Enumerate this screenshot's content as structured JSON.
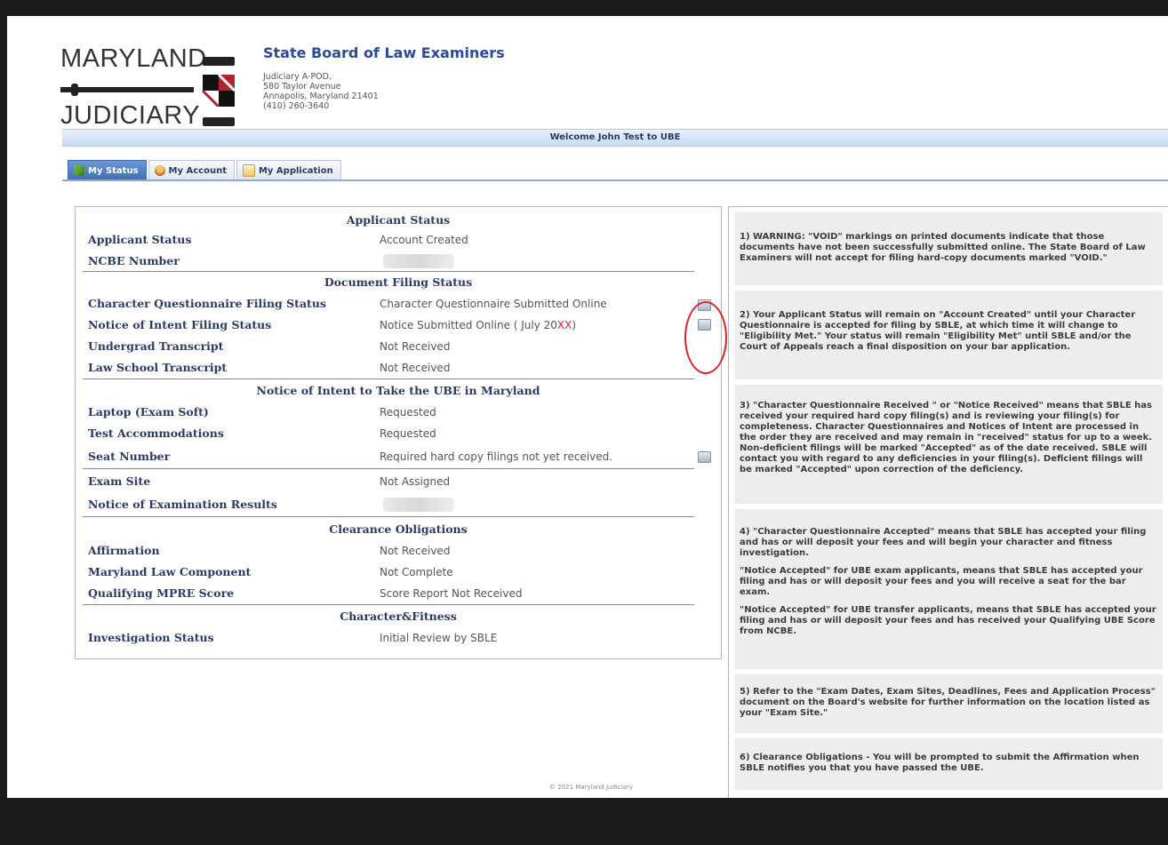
{
  "header": {
    "logo_top": "MARYLAND",
    "logo_bottom": "JUDICIARY",
    "org_title": "State Board of Law Examiners",
    "address": [
      "Judiciary A-POD,",
      "580 Taylor Avenue",
      "Annapolis, Maryland 21401",
      "(410) 260-3640"
    ]
  },
  "welcome": "Welcome John Test to UBE",
  "tabs": [
    {
      "label": "My Status",
      "icon": "flag-icon",
      "active": true
    },
    {
      "label": "My Account",
      "icon": "user-icon",
      "active": false
    },
    {
      "label": "My Application",
      "icon": "document-icon",
      "active": false
    }
  ],
  "status": {
    "applicant_section": "Applicant Status",
    "applicant_status_label": "Applicant Status",
    "applicant_status_value": "Account Created",
    "ncbe_label": "NCBE Number",
    "doc_section": "Document Filing Status",
    "cq_label": "Character Questionnaire Filing Status",
    "cq_value": "Character Questionnaire Submitted Online",
    "noi_label": "Notice of Intent  Filing Status",
    "noi_value": "Notice Submitted Online ( July 20",
    "noi_value_red": "XX",
    "noi_value_end": ")",
    "undergrad_label": "Undergrad Transcript",
    "undergrad_value": "Not Received",
    "lawschool_label": "Law School Transcript",
    "lawschool_value": "Not Received",
    "noi_section": "Notice of Intent to Take the UBE in Maryland",
    "laptop_label": "Laptop (Exam Soft)",
    "laptop_value": "Requested",
    "accom_label": "Test Accommodations",
    "accom_value": "Requested",
    "seat_label": "Seat Number",
    "seat_value": "Required hard copy filings not yet received.",
    "site_label": "Exam Site",
    "site_value": "Not Assigned",
    "results_label": "Notice of Examination Results",
    "clear_section": "Clearance Obligations",
    "affirm_label": "Affirmation",
    "affirm_value": "Not Received",
    "mlc_label": "Maryland Law Component",
    "mlc_value": "Not Complete",
    "mpre_label": "Qualifying MPRE Score",
    "mpre_value": "Score Report Not Received",
    "cf_section": "Character&Fitness",
    "invest_label": "Investigation Status",
    "invest_value": "Initial Review by SBLE"
  },
  "notes": {
    "n1": "1) WARNING: \"VOID\" markings on printed documents indicate that those documents have not been successfully submitted online. The State Board of Law Examiners will not accept for filing hard-copy documents marked \"VOID.\"",
    "n2": "2) Your Applicant Status will remain on \"Account Created\" until your Character Questionnaire is accepted for filing by SBLE, at which time it will change to \"Eligibility Met.\" Your status will remain \"Eligibility Met\" until SBLE and/or the Court of Appeals reach a final disposition on your bar application.",
    "n3": "3) \"Character Questionnaire Received \" or \"Notice Received\" means that SBLE has received your required hard copy filing(s) and is reviewing your filing(s) for completeness. Character Questionnaires and Notices of Intent are processed in the order they are received and may remain in \"received\" status for up to a week. Non-deficient filings will be marked \"Accepted\" as of the date received. SBLE will contact you with regard to any deficiencies in your filing(s). Deficient filings will be marked \"Accepted\" upon correction of the deficiency.",
    "n4a": "4) \"Character Questionnaire Accepted\" means that SBLE has accepted your filing and has or will deposit your fees and will begin your character and fitness investigation.",
    "n4b": "\"Notice Accepted\" for UBE exam applicants, means that SBLE has accepted your filing and has or will deposit your fees and you will receive a seat for the bar exam.",
    "n4c": "\"Notice Accepted\" for UBE transfer applicants, means that SBLE has accepted your filing and has or will deposit your fees and has received your Qualifying UBE Score from NCBE.",
    "n5": "5) Refer to the \"Exam Dates, Exam Sites, Deadlines, Fees and Application Process\" document on the Board's website for further information on the location listed as your \"Exam Site.\"",
    "n6": "6) Clearance Obligations - You will be prompted to submit the Affirmation when SBLE notifies you that you have passed the UBE."
  },
  "footer": "© 2021 Maryland Judiciary",
  "colors": {
    "accent": "#2b4a9b",
    "highlight_circle": "#d8262a",
    "panel_border": "#a9b9d3"
  }
}
